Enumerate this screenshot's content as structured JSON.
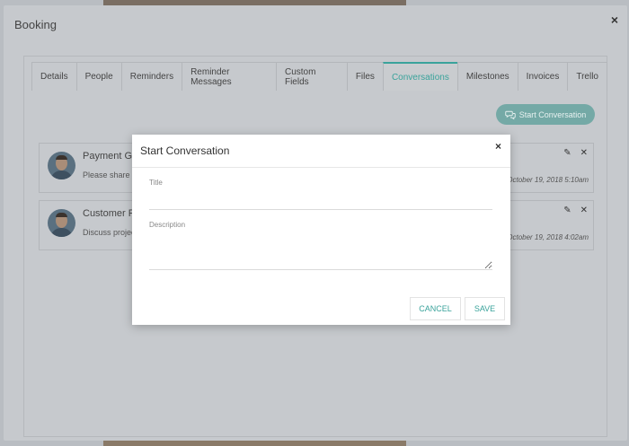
{
  "booking": {
    "title": "Booking",
    "close": "×",
    "tabs": [
      {
        "label": "Details"
      },
      {
        "label": "People"
      },
      {
        "label": "Reminders"
      },
      {
        "label": "Reminder Messages"
      },
      {
        "label": "Custom Fields"
      },
      {
        "label": "Files"
      },
      {
        "label": "Conversations"
      },
      {
        "label": "Milestones"
      },
      {
        "label": "Invoices"
      },
      {
        "label": "Trello"
      }
    ],
    "active_tab": "Conversations",
    "start_button": "Start Conversation",
    "conversations": [
      {
        "title": "Payment Ga",
        "description": "Please share y",
        "date": "October 19, 2018 5:10am"
      },
      {
        "title": "Customer P",
        "description": "Discuss projec",
        "date": "October 19, 2018 4:02am"
      }
    ]
  },
  "modal": {
    "title": "Start Conversation",
    "close": "×",
    "title_label": "Title",
    "title_value": "",
    "description_label": "Description",
    "description_value": "",
    "cancel_label": "CANCEL",
    "save_label": "SAVE"
  },
  "colors": {
    "accent": "#3aa39b",
    "overlay": "#c6c9cd",
    "modal_bg": "#ffffff"
  },
  "icons": {
    "start_button": "chat-bubbles-icon",
    "edit": "pencil-icon",
    "delete": "close-icon"
  }
}
